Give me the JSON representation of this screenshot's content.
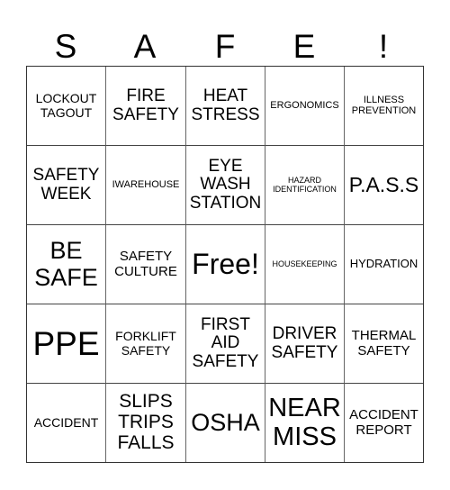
{
  "title_letters": [
    "S",
    "A",
    "F",
    "E",
    "!"
  ],
  "cells": [
    [
      "LOCKOUT\nTAGOUT",
      "FIRE\nSAFETY",
      "HEAT\nSTRESS",
      "ERGONOMICS",
      "ILLNESS\nPREVENTION"
    ],
    [
      "SAFETY\nWEEK",
      "IWAREHOUSE",
      "EYE\nWASH\nSTATION",
      "HAZARD\nIDENTIFICATION",
      "P.A.S.S"
    ],
    [
      "BE\nSAFE",
      "SAFETY\nCULTURE",
      "Free!",
      "HOUSEKEEPING",
      "HYDRATION"
    ],
    [
      "PPE",
      "FORKLIFT\nSAFETY",
      "FIRST\nAID\nSAFETY",
      "DRIVER\nSAFETY",
      "THERMAL\nSAFETY"
    ],
    [
      "ACCIDENT",
      "SLIPS\nTRIPS\nFALLS",
      "OSHA",
      "NEAR\nMISS",
      "ACCIDENT\nREPORT"
    ]
  ]
}
